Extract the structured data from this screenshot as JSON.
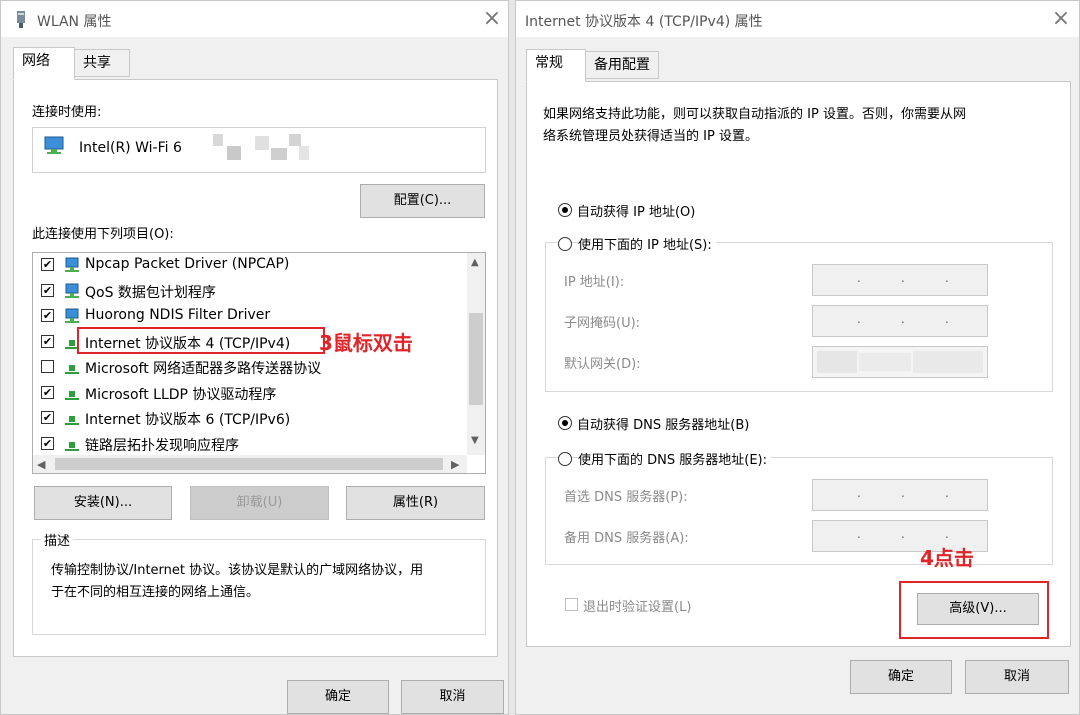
{
  "left_window": {
    "title": "WLAN 属性",
    "tabs": [
      {
        "label": "网络",
        "active": true
      },
      {
        "label": "共享",
        "active": false
      }
    ],
    "connect_using_label": "连接时使用:",
    "adapter_name": "Intel(R) Wi-Fi 6",
    "configure_button": "配置(C)...",
    "items_label": "此连接使用下列项目(O):",
    "items": [
      {
        "label": "Npcap Packet Driver (NPCAP)",
        "checked": true,
        "icon": "network-client-icon"
      },
      {
        "label": "QoS 数据包计划程序",
        "checked": true,
        "icon": "network-client-icon"
      },
      {
        "label": "Huorong NDIS Filter Driver",
        "checked": true,
        "icon": "network-client-icon"
      },
      {
        "label": "Internet 协议版本 4 (TCP/IPv4)",
        "checked": true,
        "icon": "network-protocol-icon"
      },
      {
        "label": "Microsoft 网络适配器多路传送器协议",
        "checked": false,
        "icon": "network-protocol-icon"
      },
      {
        "label": "Microsoft LLDP 协议驱动程序",
        "checked": true,
        "icon": "network-protocol-icon"
      },
      {
        "label": "Internet 协议版本 6 (TCP/IPv6)",
        "checked": true,
        "icon": "network-protocol-icon"
      },
      {
        "label": "链路层拓扑发现响应程序",
        "checked": true,
        "icon": "network-protocol-icon"
      }
    ],
    "install_button": "安装(N)...",
    "uninstall_button": "卸载(U)",
    "properties_button": "属性(R)",
    "description_legend": "描述",
    "description_text_line1": "传输控制协议/Internet 协议。该协议是默认的广域网络协议，用",
    "description_text_line2": "于在不同的相互连接的网络上通信。",
    "ok_button": "确定",
    "cancel_button": "取消",
    "annotation": "3鼠标双击"
  },
  "right_window": {
    "title": "Internet 协议版本 4 (TCP/IPv4) 属性",
    "tabs": [
      {
        "label": "常规",
        "active": true
      },
      {
        "label": "备用配置",
        "active": false
      }
    ],
    "intro_line1": "如果网络支持此功能，则可以获取自动指派的 IP 设置。否则，你需要从网",
    "intro_line2": "络系统管理员处获得适当的 IP 设置。",
    "auto_ip_label": "自动获得 IP 地址(O)",
    "manual_ip_label": "使用下面的 IP 地址(S):",
    "ip_address_label": "IP 地址(I):",
    "subnet_label": "子网掩码(U):",
    "gateway_label": "默认网关(D):",
    "auto_dns_label": "自动获得 DNS 服务器地址(B)",
    "manual_dns_label": "使用下面的 DNS 服务器地址(E):",
    "preferred_dns_label": "首选 DNS 服务器(P):",
    "alternate_dns_label": "备用 DNS 服务器(A):",
    "ip_separator": ".",
    "validate_label": "退出时验证设置(L)",
    "advanced_button": "高级(V)...",
    "ok_button": "确定",
    "cancel_button": "取消",
    "annotation": "4点击"
  },
  "colors": {
    "annotation_red": "#e0252a",
    "window_bg": "#f0f0f0"
  }
}
